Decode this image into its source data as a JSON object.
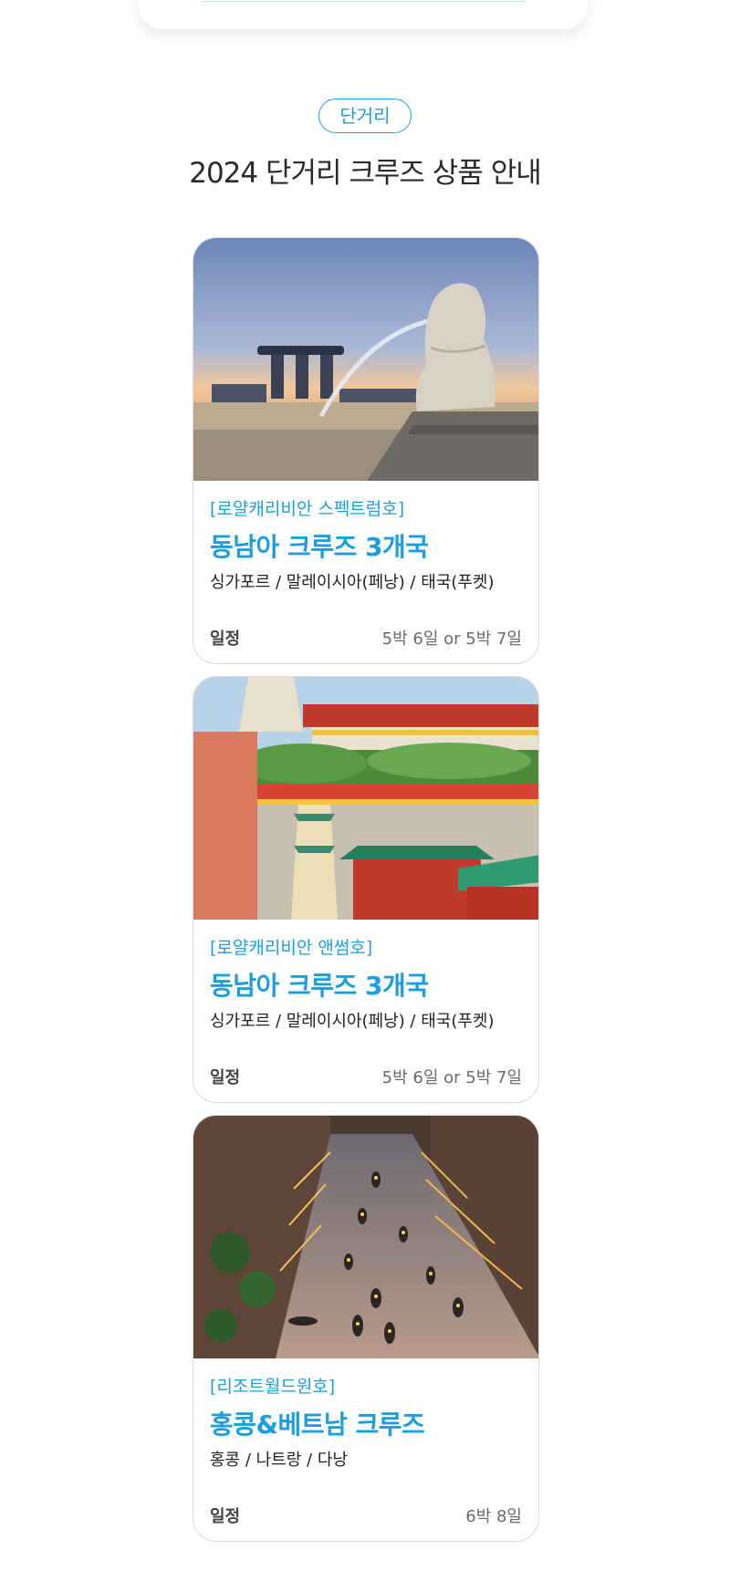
{
  "section": {
    "tag": "단거리",
    "title": "2024 단거리 크루즈 상품 안내"
  },
  "cards": [
    {
      "ship": "[로얄캐리비안 스펙트럼호]",
      "title": "동남아 크루즈 3개국",
      "route": "싱가포르 / 말레이시아(페낭) / 태국(푸켓)",
      "schedule_label": "일정",
      "schedule_value": "5박 6일 or 5박 7일",
      "image": "singapore-merlion-marina-bay-photo"
    },
    {
      "ship": "[로얄캐리비안 앤썸호]",
      "title": "동남아 크루즈 3개국",
      "route": "싱가포르 / 말레이시아(페낭) / 태국(푸켓)",
      "schedule_label": "일정",
      "schedule_value": "5박 6일 or 5박 7일",
      "image": "penang-temple-photo"
    },
    {
      "ship": "[리조트월드원호]",
      "title": "홍콩&베트남 크루즈",
      "route": "홍콩 / 나트랑 / 다낭",
      "schedule_label": "일정",
      "schedule_value": "6박 8일",
      "image": "hoi-an-lantern-river-photo"
    }
  ],
  "colors": {
    "accent": "#1b9ee0"
  }
}
